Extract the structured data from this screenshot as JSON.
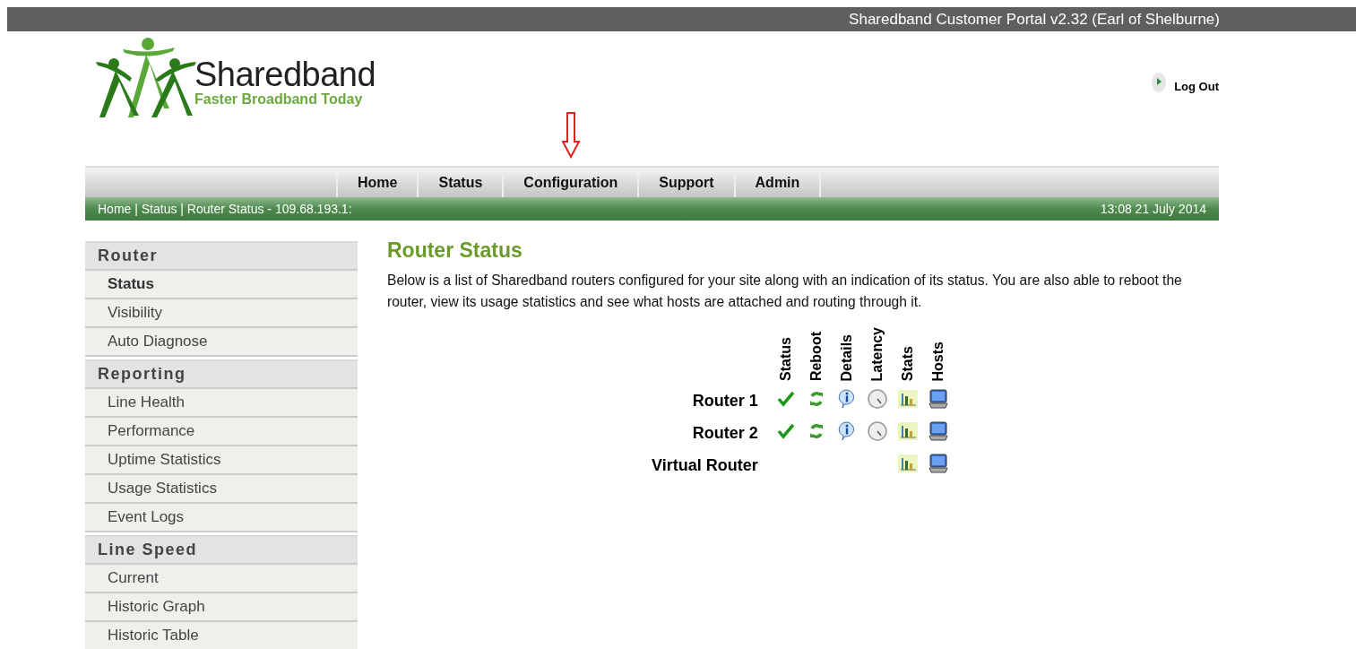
{
  "top_bar": {
    "title": "Sharedband Customer Portal v2.32 (Earl of Shelburne)"
  },
  "logo": {
    "name": "Sharedband",
    "tagline": "Faster Broadband Today"
  },
  "logout": {
    "label": "Log Out"
  },
  "nav": [
    {
      "label": "Home"
    },
    {
      "label": "Status"
    },
    {
      "label": "Configuration",
      "annotated": true
    },
    {
      "label": "Support"
    },
    {
      "label": "Admin"
    }
  ],
  "breadcrumb": {
    "path": "Home | Status | Router Status  - 109.68.193.1:",
    "datetime": "13:08 21 July 2014"
  },
  "sidebar": [
    {
      "header": "Router",
      "items": [
        {
          "label": "Status",
          "selected": true
        },
        {
          "label": "Visibility",
          "selected": false
        },
        {
          "label": "Auto Diagnose",
          "selected": false
        }
      ]
    },
    {
      "header": "Reporting",
      "items": [
        {
          "label": "Line Health",
          "selected": false
        },
        {
          "label": "Performance",
          "selected": false
        },
        {
          "label": "Uptime Statistics",
          "selected": false
        },
        {
          "label": "Usage Statistics",
          "selected": false
        },
        {
          "label": "Event Logs",
          "selected": false
        }
      ]
    },
    {
      "header": "Line Speed",
      "items": [
        {
          "label": "Current",
          "selected": false
        },
        {
          "label": "Historic Graph",
          "selected": false
        },
        {
          "label": "Historic Table",
          "selected": false
        }
      ]
    }
  ],
  "content": {
    "title": "Router Status",
    "description": "Below is a list of Sharedband routers configured for your site along with an indication of its status. You are also able to reboot the router, view its usage statistics and see what hosts are attached and routing through it.",
    "table": {
      "columns": [
        "Status",
        "Reboot",
        "Details",
        "Latency",
        "Stats",
        "Hosts"
      ],
      "rows": [
        {
          "name": "Router 1",
          "cells": [
            {
              "kind": "check"
            },
            {
              "kind": "reboot"
            },
            {
              "kind": "info"
            },
            {
              "kind": "gauge"
            },
            {
              "kind": "chart"
            },
            {
              "kind": "computer"
            }
          ]
        },
        {
          "name": "Router 2",
          "cells": [
            {
              "kind": "check"
            },
            {
              "kind": "reboot"
            },
            {
              "kind": "info"
            },
            {
              "kind": "gauge"
            },
            {
              "kind": "chart"
            },
            {
              "kind": "computer"
            }
          ]
        },
        {
          "name": "Virtual Router",
          "cells": [
            {
              "kind": "empty"
            },
            {
              "kind": "empty"
            },
            {
              "kind": "empty"
            },
            {
              "kind": "empty"
            },
            {
              "kind": "chart"
            },
            {
              "kind": "computer"
            }
          ]
        }
      ]
    }
  }
}
